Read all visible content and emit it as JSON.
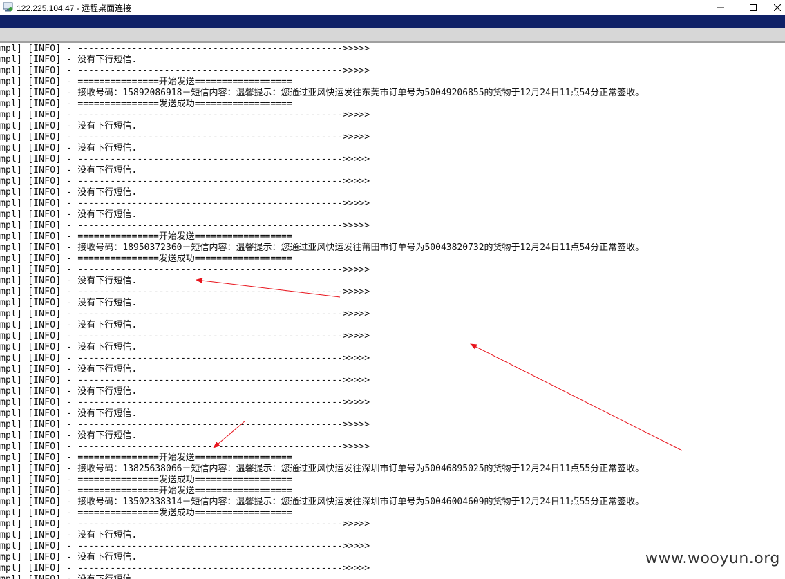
{
  "window": {
    "title": "122.225.104.47 - 远程桌面连接",
    "minimize": "—",
    "maximize": "☐",
    "close": "✕"
  },
  "log": {
    "prefix": "mpl] [INFO] - ",
    "lines": [
      "------------------------------------------------->>>>>",
      "没有下行短信.",
      "------------------------------------------------->>>>>",
      "===============开始发送==================",
      "接收号码：15892086918－短信内容：温馨提示：您通过亚风快运发往东莞市订单号为50049206855的货物于12月24日11点54分正常签收。",
      "===============发送成功==================",
      "------------------------------------------------->>>>>",
      "没有下行短信.",
      "------------------------------------------------->>>>>",
      "没有下行短信.",
      "------------------------------------------------->>>>>",
      "没有下行短信.",
      "------------------------------------------------->>>>>",
      "没有下行短信.",
      "------------------------------------------------->>>>>",
      "没有下行短信.",
      "------------------------------------------------->>>>>",
      "===============开始发送==================",
      "接收号码：18950372360－短信内容：温馨提示：您通过亚风快运发往莆田市订单号为50043820732的货物于12月24日11点54分正常签收。",
      "===============发送成功==================",
      "------------------------------------------------->>>>>",
      "没有下行短信.",
      "------------------------------------------------->>>>>",
      "没有下行短信.",
      "------------------------------------------------->>>>>",
      "没有下行短信.",
      "------------------------------------------------->>>>>",
      "没有下行短信.",
      "------------------------------------------------->>>>>",
      "没有下行短信.",
      "------------------------------------------------->>>>>",
      "没有下行短信.",
      "------------------------------------------------->>>>>",
      "没有下行短信.",
      "------------------------------------------------->>>>>",
      "没有下行短信.",
      "------------------------------------------------->>>>>",
      "===============开始发送==================",
      "接收号码：13825638066－短信内容：温馨提示：您通过亚风快运发往深圳市订单号为50046895025的货物于12月24日11点55分正常签收。",
      "===============发送成功==================",
      "===============开始发送==================",
      "接收号码：13502338314－短信内容：温馨提示：您通过亚风快运发往深圳市订单号为50046004609的货物于12月24日11点55分正常签收。",
      "===============发送成功==================",
      "------------------------------------------------->>>>>",
      "没有下行短信.",
      "------------------------------------------------->>>>>",
      "没有下行短信.",
      "------------------------------------------------->>>>>",
      "没有下行短信."
    ]
  },
  "watermark": "www.wooyun.org",
  "colors": {
    "titlebar_blue": "#0f2167",
    "annotation_arrow": "#e8141c"
  }
}
